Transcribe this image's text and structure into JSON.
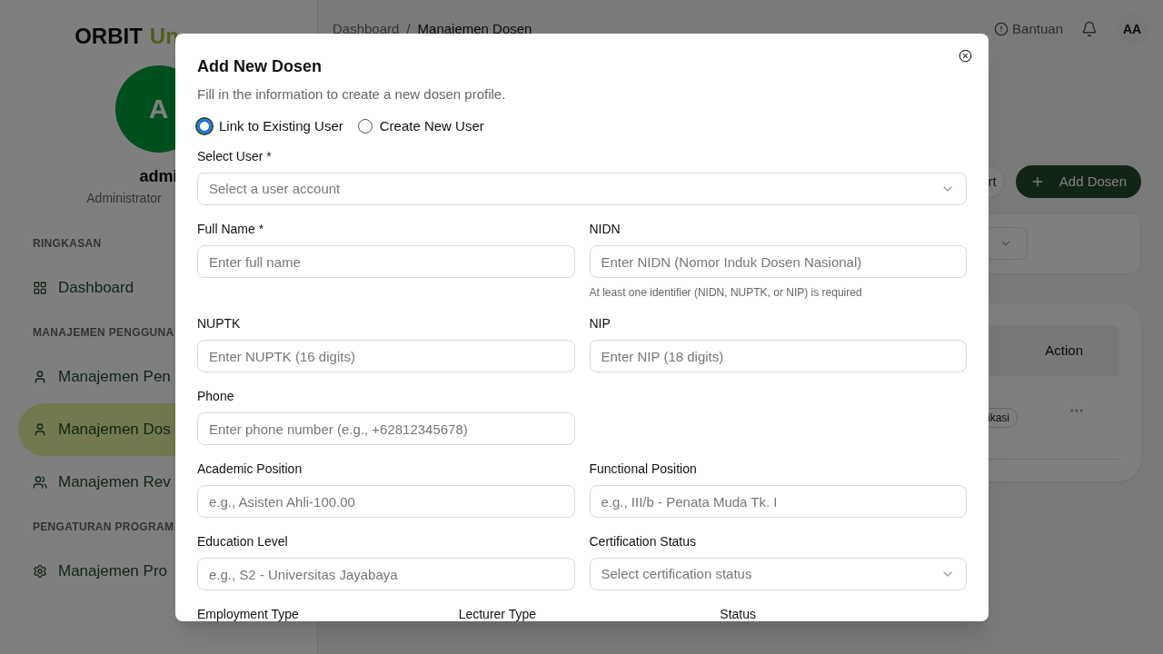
{
  "sidebar": {
    "logo": {
      "primary": "ORBIT",
      "accent": "Un"
    },
    "avatar": {
      "initial": "A"
    },
    "user": {
      "name": "admi",
      "role": "Administrator"
    },
    "sections": [
      {
        "title": "RINGKASAN",
        "items": [
          {
            "label": "Dashboard",
            "selected": false
          }
        ]
      },
      {
        "title": "MANAJEMEN PENGGUNA",
        "items": [
          {
            "label": "Manajemen Pen",
            "selected": false
          },
          {
            "label": "Manajemen Dos",
            "selected": true
          },
          {
            "label": "Manajemen Rev",
            "selected": false
          }
        ]
      },
      {
        "title": "PENGATURAN PROGRAM",
        "items": [
          {
            "label": "Manajemen Pro",
            "selected": false
          }
        ]
      }
    ]
  },
  "header": {
    "breadcrumb": [
      "Dashboard",
      "Manajemen Dosen"
    ],
    "separator": "/",
    "help": "Bantuan",
    "avatar": "AA"
  },
  "page": {
    "export_button": "rt",
    "add_button": "Add Dosen",
    "table_header": "Action",
    "badge": "ikasi"
  },
  "modal": {
    "title": "Add New Dosen",
    "description": "Fill in the information to create a new dosen profile.",
    "user_mode": [
      {
        "label": "Link to Existing User",
        "selected": true
      },
      {
        "label": "Create New User",
        "selected": false
      }
    ],
    "rows": [
      [
        {
          "label": "Select User *",
          "kind": "select",
          "placeholder": "Select a user account"
        }
      ],
      [
        {
          "label": "Full Name *",
          "kind": "input",
          "placeholder": "Enter full name"
        },
        {
          "label": "NIDN",
          "kind": "input",
          "placeholder": "Enter NIDN (Nomor Induk Dosen Nasional)",
          "help": "At least one identifier (NIDN, NUPTK, or NIP) is required"
        }
      ],
      [
        {
          "label": "NUPTK",
          "kind": "input",
          "placeholder": "Enter NUPTK (16 digits)"
        },
        {
          "label": "NIP",
          "kind": "input",
          "placeholder": "Enter NIP (18 digits)"
        }
      ],
      [
        {
          "label": "Phone",
          "kind": "input",
          "placeholder": "Enter phone number (e.g., +62812345678)"
        },
        {
          "kind": "empty"
        }
      ],
      [
        {
          "label": "Academic Position",
          "kind": "input",
          "placeholder": "e.g., Asisten Ahli-100.00"
        },
        {
          "label": "Functional Position",
          "kind": "input",
          "placeholder": "e.g., III/b - Penata Muda Tk. I"
        }
      ],
      [
        {
          "label": "Education Level",
          "kind": "input",
          "placeholder": "e.g., S2 - Universitas Jayabaya"
        },
        {
          "label": "Certification Status",
          "kind": "select",
          "placeholder": "Select certification status"
        }
      ],
      [
        {
          "label": "Employment Type",
          "kind": "label"
        },
        {
          "label": "Lecturer Type",
          "kind": "label"
        },
        {
          "label": "Status",
          "kind": "label"
        }
      ]
    ]
  }
}
